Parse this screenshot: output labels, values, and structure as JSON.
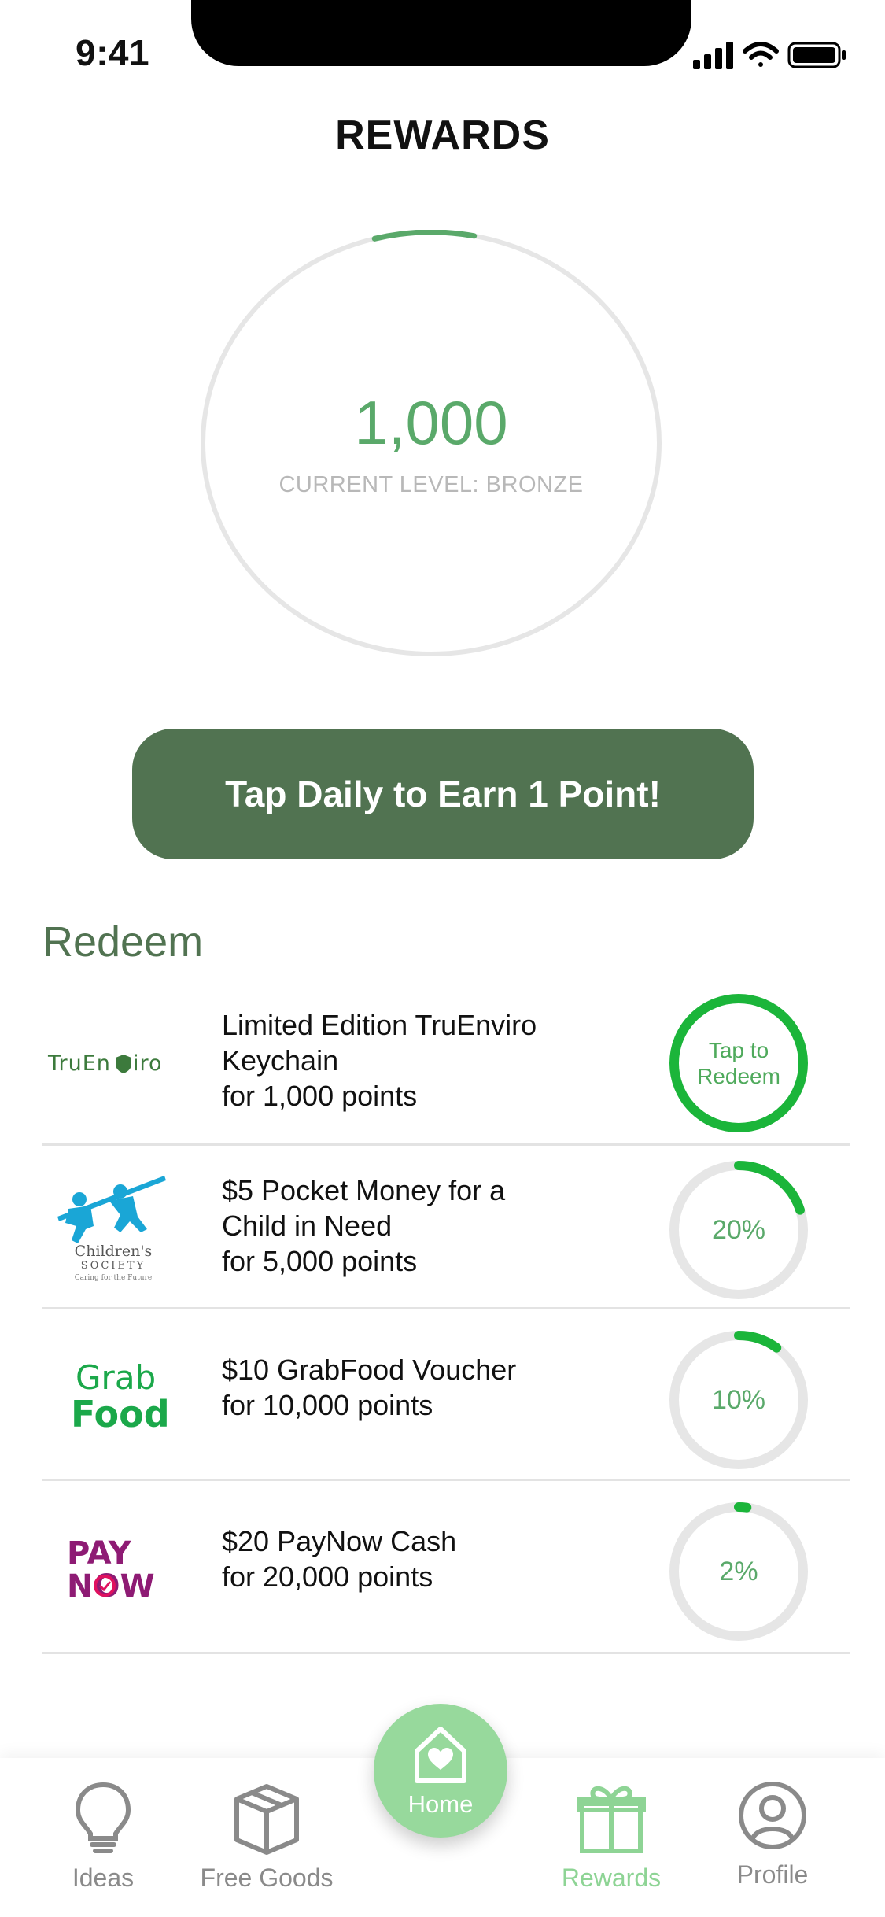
{
  "status_bar": {
    "time": "9:41"
  },
  "header": {
    "title": "REWARDS"
  },
  "points": {
    "value": "1,000",
    "level_text": "CURRENT LEVEL: BRONZE",
    "progress": 0.07
  },
  "earn_button": {
    "label": "Tap Daily to Earn 1 Point!"
  },
  "redeem": {
    "title": "Redeem",
    "items": [
      {
        "logo": "TruEnviro",
        "text": "Limited Edition TruEnviro\nKeychain\nfor 1,000 points",
        "status_label": "Tap to\nRedeem",
        "progress": 1.0
      },
      {
        "logo": "Children's Society",
        "logo_line1": "Children's",
        "logo_line2": "SOCIETY",
        "logo_line3": "Caring for the Future",
        "text": "$5 Pocket Money for a\nChild in Need\nfor 5,000 points",
        "status_label": "20%",
        "progress": 0.2
      },
      {
        "logo": "GrabFood",
        "logo_line1": "Grab",
        "logo_line2": "Food",
        "text": "$10 GrabFood Voucher\nfor 10,000 points",
        "status_label": "10%",
        "progress": 0.1
      },
      {
        "logo": "PayNow",
        "logo_line1": "PAY",
        "logo_line2": "NOW",
        "text": "$20 PayNow Cash\nfor 20,000 points",
        "status_label": "2%",
        "progress": 0.02
      }
    ]
  },
  "nav": {
    "ideas": "Ideas",
    "free_goods": "Free Goods",
    "home": "Home",
    "rewards": "Rewards",
    "profile": "Profile"
  },
  "colors": {
    "accent_green": "#5aa96a",
    "button_green": "#517351",
    "bright_green": "#1bb53a",
    "nav_active": "#8ed495",
    "ring_gray": "#e6e6e6"
  }
}
